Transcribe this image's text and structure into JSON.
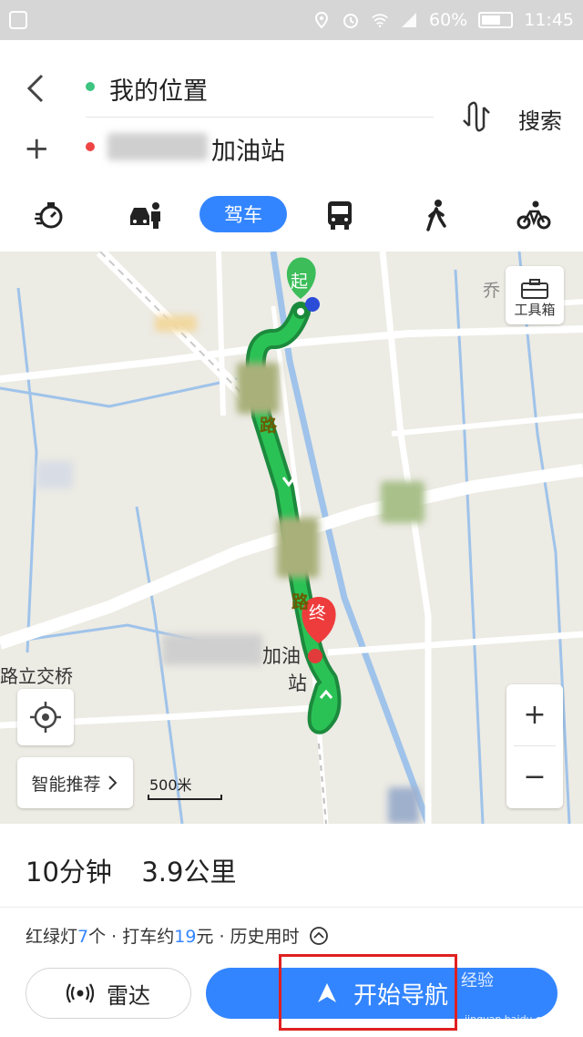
{
  "status_bar": {
    "battery": "60%",
    "time": "11:45"
  },
  "route_inputs": {
    "origin": "我的位置",
    "destination": "加油站",
    "search_label": "搜索"
  },
  "modes": {
    "active_label": "驾车"
  },
  "map": {
    "start_marker": "起",
    "end_marker": "终",
    "road_char_1": "路",
    "road_char_2": "路",
    "poi_label_1": "加油",
    "poi_label_2": "站",
    "bridge_label": "路立交桥",
    "corner_label": "乔",
    "toolbox_label": "工具箱",
    "smart_label": "智能推荐",
    "scale_label": "500米",
    "zoom_in": "+",
    "zoom_out": "−"
  },
  "summary": {
    "time": "10分钟",
    "distance": "3.9公里"
  },
  "route_info": {
    "lights_prefix": "红绿灯",
    "lights_count": "7",
    "lights_suffix": "个 · 打车约",
    "fare": "19",
    "fare_suffix": "元 · 历史用时"
  },
  "actions": {
    "radar_label": "雷达",
    "start_nav_label": "开始导航"
  },
  "watermark": {
    "text": "经验",
    "url": "jingyan.baidu.com"
  },
  "colors": {
    "accent": "#3385ff",
    "route": "#1aa34a",
    "origin_dot": "#3cc480",
    "dest_dot": "#ef4444"
  }
}
